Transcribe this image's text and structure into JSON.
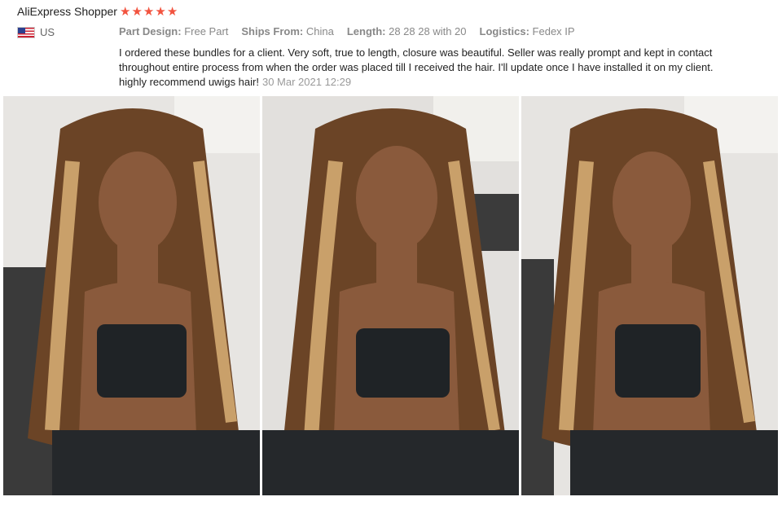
{
  "review": {
    "reviewer": "AliExpress Shopper",
    "rating": 5,
    "country": "US",
    "icons": {
      "star": "star-icon",
      "flag": "us-flag-icon"
    },
    "meta": [
      {
        "label": "Part Design:",
        "value": "Free Part"
      },
      {
        "label": "Ships From:",
        "value": "China"
      },
      {
        "label": "Length:",
        "value": "28 28 28 with 20"
      },
      {
        "label": "Logistics:",
        "value": "Fedex IP"
      }
    ],
    "text": "I ordered these bundles for a client. Very soft, true to length, closure was beautiful. Seller was really prompt and kept in contact throughout entire process from when the order was placed till I received the hair. I'll update once I have installed it on my client. highly recommend uwigs hair!",
    "date": "30 Mar 2021 12:29"
  },
  "colors": {
    "star": "#f2533f",
    "hair": "#6b4426",
    "highlight": "#c9a06a",
    "top": "#1f2326",
    "skin": "#8a5a3c"
  }
}
